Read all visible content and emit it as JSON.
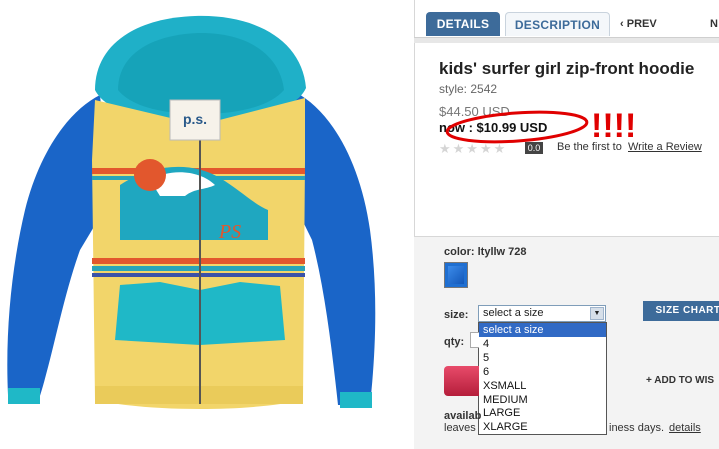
{
  "tabs": [
    {
      "label": "DETAILS",
      "active": true
    },
    {
      "label": "DESCRIPTION",
      "active": false
    }
  ],
  "nav": {
    "prev": "PREV",
    "next": "N"
  },
  "product": {
    "title": "kids' surfer girl zip-front hoodie",
    "style": "style: 2542",
    "original_price": "$44.50 USD",
    "now_price": "now : $10.99 USD",
    "annotation_marks": "!!!!",
    "brand_tag": "p.s.",
    "graphic_text": "PS"
  },
  "rating": {
    "value": "0.0",
    "stars_max": 5,
    "be_first": "Be the first to",
    "review_link": "Write a Review"
  },
  "color": {
    "label": "color: ltyllw 728",
    "swatch_hex": "#1f6fd1"
  },
  "size": {
    "label": "size:",
    "selected": "select a size",
    "options": [
      "select a size",
      "4",
      "5",
      "6",
      "XSMALL",
      "MEDIUM",
      "LARGE",
      "XLARGE"
    ],
    "chart_button": "SIZE CHART"
  },
  "qty": {
    "label": "qty:"
  },
  "wishlist": {
    "label": "+ ADD TO WIS"
  },
  "availability": {
    "label": "availab",
    "leaves_text": "leaves",
    "days_text": "iness days.",
    "details_link": "details"
  },
  "colors": {
    "tab_active": "#3d6b9a",
    "annotation_red": "#e00000",
    "dropdown_selected": "#316ac5"
  }
}
